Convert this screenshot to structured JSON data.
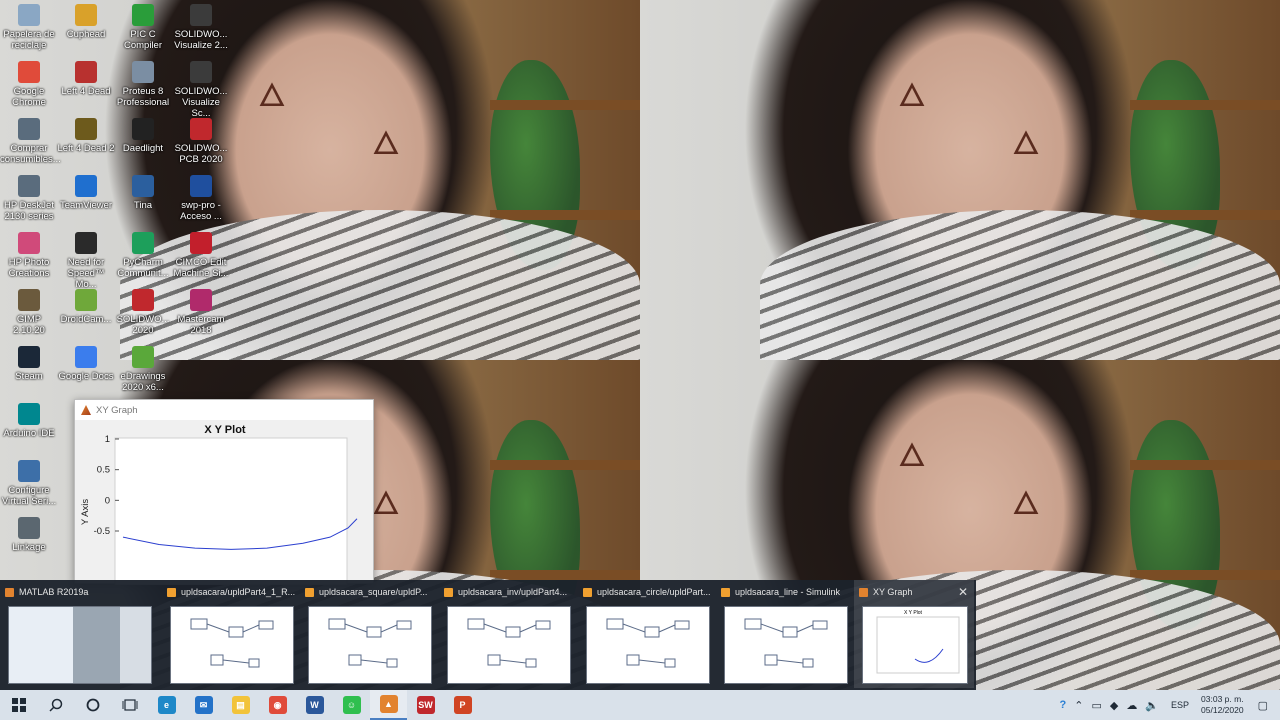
{
  "desktop": {
    "icons": [
      {
        "label": "Papelera de\nreciclaje",
        "icon": "recycle-bin-icon",
        "color": "#8aa7c4"
      },
      {
        "label": "Cuphead",
        "icon": "cuphead-icon",
        "color": "#d9a12a"
      },
      {
        "label": "PIC C\nCompiler",
        "icon": "pic-c-icon",
        "color": "#2a9d3a"
      },
      {
        "label": "SOLIDWO...\nVisualize 2...",
        "icon": "solidworks-visualize-icon",
        "color": "#3b3b3b"
      },
      {
        "label": "Google\nChrome",
        "icon": "chrome-icon",
        "color": "#e04b3a"
      },
      {
        "label": "Left 4 Dead",
        "icon": "left4dead-icon",
        "color": "#b8312f"
      },
      {
        "label": "Proteus 8\nProfessional",
        "icon": "proteus-icon",
        "color": "#7b8ea3"
      },
      {
        "label": "SOLIDWO...\nVisualize Sc...",
        "icon": "solidworks-visualize-icon",
        "color": "#3b3b3b"
      },
      {
        "label": "Comprar\nconsumibles...",
        "icon": "printer-icon",
        "color": "#5a6c7d"
      },
      {
        "label": "Left 4 Dead 2",
        "icon": "left4dead2-icon",
        "color": "#6d5a1c"
      },
      {
        "label": "Daedlight",
        "icon": "daedlight-icon",
        "color": "#222"
      },
      {
        "label": "SOLIDWO...\nPCB 2020",
        "icon": "solidworks-pcb-icon",
        "color": "#c0282d"
      },
      {
        "label": "HP DeskJet\n2130 series",
        "icon": "printer-icon",
        "color": "#5a6c7d"
      },
      {
        "label": "TeamViewer",
        "icon": "teamviewer-icon",
        "color": "#1f6fcf"
      },
      {
        "label": "Tina",
        "icon": "tina-icon",
        "color": "#2b5f9e"
      },
      {
        "label": "swp-pro -\nAcceso ...",
        "icon": "shortcut-icon",
        "color": "#1f4f9e"
      },
      {
        "label": "HP Photo\nCreations",
        "icon": "hp-photo-icon",
        "color": "#d04a7a"
      },
      {
        "label": "Need for\nSpeed™ Mo...",
        "icon": "nfs-icon",
        "color": "#2a2a2a"
      },
      {
        "label": "PyCharm\nCommunit...",
        "icon": "pycharm-icon",
        "color": "#1d9f5b"
      },
      {
        "label": "CIMCO Edit\nMachine Si...",
        "icon": "cimco-icon",
        "color": "#c21f2c"
      },
      {
        "label": "GIMP 2.10.20",
        "icon": "gimp-icon",
        "color": "#6b5a3d"
      },
      {
        "label": "DroidCam...",
        "icon": "droidcam-icon",
        "color": "#6fa83a"
      },
      {
        "label": "SOLIDWO...\n2020",
        "icon": "solidworks-icon",
        "color": "#c0282d"
      },
      {
        "label": "Mastercam\n2018",
        "icon": "mastercam-icon",
        "color": "#b02a6b"
      },
      {
        "label": "Steam",
        "icon": "steam-icon",
        "color": "#1b2838"
      },
      {
        "label": "Google Docs",
        "icon": "google-docs-icon",
        "color": "#3b7ded"
      },
      {
        "label": "eDrawings\n2020 x6...",
        "icon": "edrawings-icon",
        "color": "#5aa83a"
      },
      {
        "label": "Arduino IDE",
        "icon": "arduino-icon",
        "color": "#00878f"
      },
      {
        "label": "Configure\nVirtual Seri...",
        "icon": "virtual-serial-icon",
        "color": "#3d6fa8"
      },
      {
        "label": "Linkage",
        "icon": "linkage-icon",
        "color": "#5b6770"
      }
    ]
  },
  "xy_window": {
    "title_bar": "XY Graph",
    "plot_title": "X Y Plot",
    "ylabel": "Y Axis",
    "yticks": [
      "1",
      "0.5",
      "0",
      "-0.5"
    ]
  },
  "chart_data": {
    "type": "line",
    "title": "X Y Plot",
    "ylabel": "Y Axis",
    "ylim": [
      -0.5,
      1
    ],
    "series": [
      {
        "values": [
          [
            -0.6,
            -0.6
          ],
          [
            -0.4,
            -0.72
          ],
          [
            -0.2,
            -0.78
          ],
          [
            0.0,
            -0.8
          ],
          [
            0.2,
            -0.78
          ],
          [
            0.4,
            -0.7
          ],
          [
            0.55,
            -0.6
          ],
          [
            0.65,
            -0.45
          ],
          [
            0.7,
            -0.3
          ]
        ]
      }
    ],
    "color": "#2b3fcf"
  },
  "thumbnails": [
    {
      "label": "MATLAB R2019a",
      "color": "#e2832f"
    },
    {
      "label": "upldsacara/upldPart4_1_R...",
      "color": "#f0a030"
    },
    {
      "label": "upldsacara_square/upldP...",
      "color": "#f0a030"
    },
    {
      "label": "upldsacara_inv/upldPart4...",
      "color": "#f0a030"
    },
    {
      "label": "upldsacara_circle/upldPart...",
      "color": "#f0a030"
    },
    {
      "label": "upldsacara_line - Simulink",
      "color": "#f0a030"
    },
    {
      "label": "XY Graph",
      "color": "#e2832f"
    }
  ],
  "xy_thumb_plot_title": "X Y Plot",
  "close_glyph": "✕",
  "taskbar": {
    "apps": [
      {
        "name": "edge-icon",
        "color": "#1e88c8",
        "glyph": "e"
      },
      {
        "name": "mail-icon",
        "color": "#2472c8",
        "glyph": "✉"
      },
      {
        "name": "file-explorer-icon",
        "color": "#f2c33a",
        "glyph": "▤"
      },
      {
        "name": "chrome-icon",
        "color": "#e04b3a",
        "glyph": "◉"
      },
      {
        "name": "word-icon",
        "color": "#2b579a",
        "glyph": "W"
      },
      {
        "name": "chat-icon",
        "color": "#2fbf4f",
        "glyph": "☺"
      },
      {
        "name": "matlab-icon",
        "color": "#e2832f",
        "glyph": "▲"
      },
      {
        "name": "solidworks-icon",
        "color": "#c0282d",
        "glyph": "SW"
      },
      {
        "name": "powerpoint-icon",
        "color": "#d04423",
        "glyph": "P"
      }
    ],
    "language": "ESP",
    "time": "03:03 p. m.",
    "date": "05/12/2020"
  }
}
